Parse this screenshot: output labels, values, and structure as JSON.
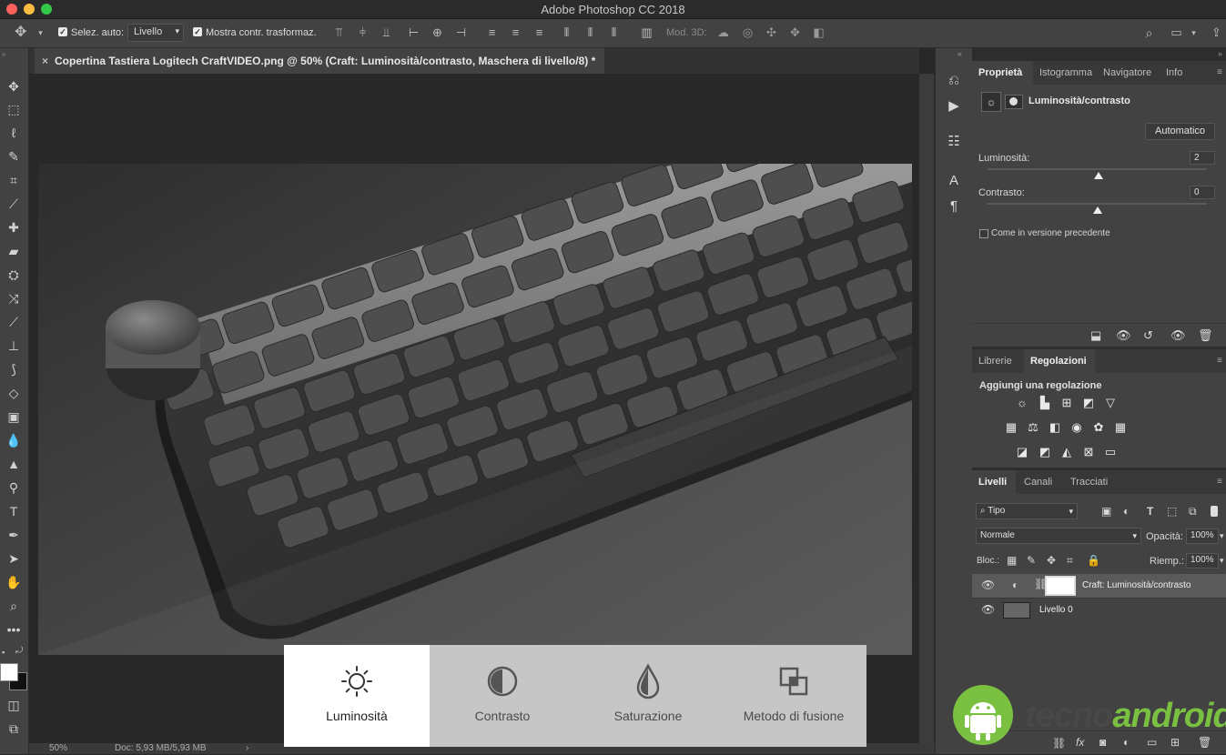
{
  "app": {
    "title": "Adobe Photoshop CC 2018"
  },
  "options_bar": {
    "auto_select_label": "Selez. auto:",
    "auto_select_value": "Livello",
    "show_transform_label": "Mostra contr. trasformaz.",
    "mode_3d_label": "Mod. 3D:"
  },
  "document": {
    "tab_title": "Copertina Tastiera Logitech CraftVIDEO.png @ 50% (Craft: Luminosità/contrasto, Maschera di livello/8) *",
    "zoom": "50%",
    "doc_info": "Doc: 5,93 MB/5,93 MB",
    "photo_subject": "keyboard-photo"
  },
  "properties_panel": {
    "tabs": [
      "Proprietà",
      "Istogramma",
      "Navigatore",
      "Info"
    ],
    "active_tab": "Proprietà",
    "heading": "Luminosità/contrasto",
    "auto_button": "Automatico",
    "brightness_label": "Luminosità:",
    "brightness_value": "2",
    "brightness_level": 0.505,
    "contrast_label": "Contrasto:",
    "contrast_value": "0",
    "contrast_level": 0.5,
    "legacy_label": "Come in versione precedente"
  },
  "adjustments_panel": {
    "tabs": [
      "Librerie",
      "Regolazioni"
    ],
    "active_tab": "Regolazioni",
    "heading": "Aggiungi una regolazione"
  },
  "layers_panel": {
    "tabs": [
      "Livelli",
      "Canali",
      "Tracciati"
    ],
    "active_tab": "Livelli",
    "filter_label": "Tipo",
    "blend_mode": "Normale",
    "opacity_label": "Opacità:",
    "opacity_value": "100%",
    "lock_label": "Bloc.:",
    "fill_label": "Riemp.:",
    "fill_value": "100%",
    "layers": [
      {
        "name": "Craft: Luminosità/contrasto"
      },
      {
        "name": "Livello 0"
      }
    ]
  },
  "overlay": {
    "items": [
      {
        "label": "Luminosità",
        "icon": "sun-icon",
        "active": true
      },
      {
        "label": "Contrasto",
        "icon": "contrast-icon",
        "active": false
      },
      {
        "label": "Saturazione",
        "icon": "drop-icon",
        "active": false
      },
      {
        "label": "Metodo di fusione",
        "icon": "blend-icon",
        "active": false
      }
    ]
  },
  "watermark": {
    "part1": "tecno",
    "part2": "android"
  },
  "colors": {
    "panel": "#424242",
    "accent_green": "#7ac142",
    "overlay_active": "#ffffff",
    "overlay_inactive": "#c6c6c6"
  }
}
